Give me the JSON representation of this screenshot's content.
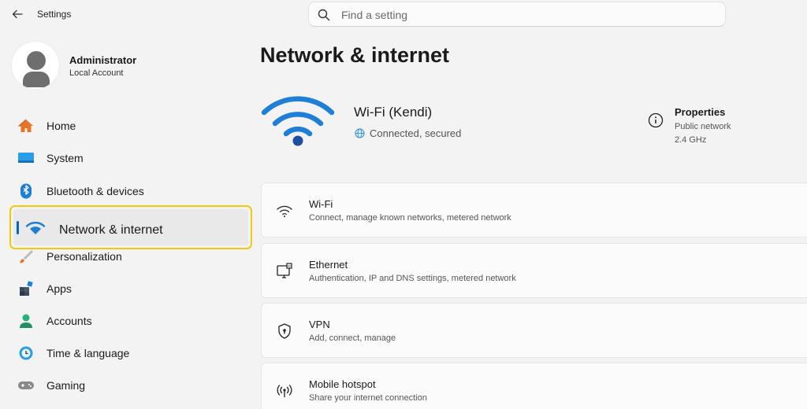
{
  "window": {
    "title": "Settings"
  },
  "search": {
    "placeholder": "Find a setting"
  },
  "profile": {
    "name": "Administrator",
    "account_type": "Local Account"
  },
  "sidebar": {
    "items": [
      {
        "label": "Home",
        "icon": "home-icon"
      },
      {
        "label": "System",
        "icon": "system-icon"
      },
      {
        "label": "Bluetooth & devices",
        "icon": "bluetooth-icon"
      },
      {
        "label": "Network & internet",
        "icon": "wifi-icon",
        "selected": true
      },
      {
        "label": "Personalization",
        "icon": "brush-icon"
      },
      {
        "label": "Apps",
        "icon": "apps-icon"
      },
      {
        "label": "Accounts",
        "icon": "accounts-icon"
      },
      {
        "label": "Time & language",
        "icon": "clock-icon"
      },
      {
        "label": "Gaming",
        "icon": "gamepad-icon"
      }
    ]
  },
  "main": {
    "title": "Network & internet",
    "connection": {
      "name": "Wi-Fi (Kendi)",
      "status": "Connected, secured"
    },
    "properties": {
      "label": "Properties",
      "network_type": "Public network",
      "band": "2.4 GHz"
    },
    "cards": [
      {
        "title": "Wi-Fi",
        "subtitle": "Connect, manage known networks, metered network",
        "icon": "wifi-icon"
      },
      {
        "title": "Ethernet",
        "subtitle": "Authentication, IP and DNS settings, metered network",
        "icon": "ethernet-icon"
      },
      {
        "title": "VPN",
        "subtitle": "Add, connect, manage",
        "icon": "vpn-shield-icon"
      },
      {
        "title": "Mobile hotspot",
        "subtitle": "Share your internet connection",
        "icon": "hotspot-icon"
      }
    ]
  },
  "colors": {
    "accent": "#0067c0",
    "highlight": "#f2c811",
    "wifi_blue": "#1f7fd6"
  }
}
